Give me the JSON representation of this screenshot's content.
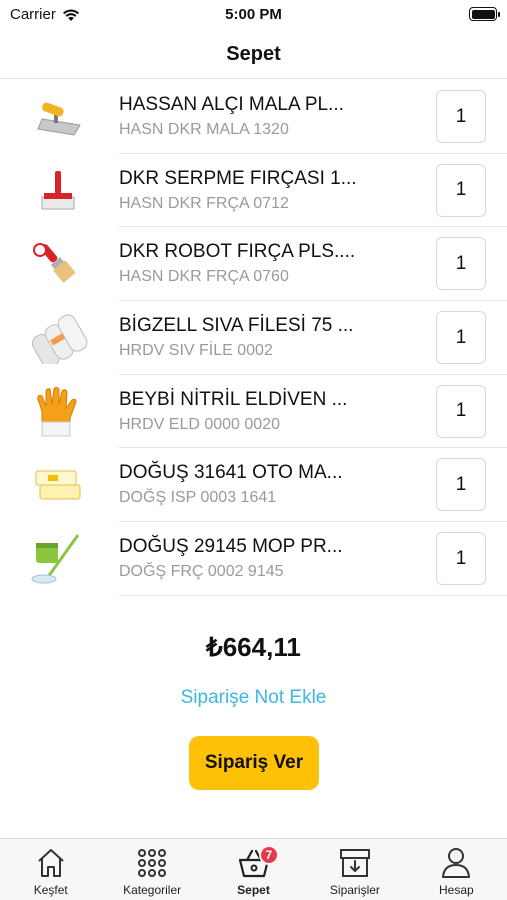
{
  "status_bar": {
    "carrier": "Carrier",
    "time": "5:00 PM"
  },
  "nav": {
    "title": "Sepet"
  },
  "cart": {
    "items": [
      {
        "name": "HASSAN ALÇI MALA PL...",
        "code": "HASN DKR MALA 1320",
        "qty": "1",
        "icon": "trowel-icon"
      },
      {
        "name": "DKR SERPME FIRÇASI 1...",
        "code": "HASN DKR FRÇA 0712",
        "qty": "1",
        "icon": "brush-icon"
      },
      {
        "name": "DKR ROBOT FIRÇA PLS....",
        "code": "HASN DKR FRÇA 0760",
        "qty": "1",
        "icon": "paint-brush-icon"
      },
      {
        "name": "BİGZELL SIVA FİLESİ 75 ...",
        "code": "HRDV SIV FİLE 0002",
        "qty": "1",
        "icon": "mesh-roll-icon"
      },
      {
        "name": "BEYBİ NİTRİL ELDİVEN ...",
        "code": "HRDV ELD 0000 0020",
        "qty": "1",
        "icon": "glove-icon"
      },
      {
        "name": "DOĞUŞ 31641 OTO MA...",
        "code": "DOĞŞ ISP 0003 1641",
        "qty": "1",
        "icon": "sponge-icon"
      },
      {
        "name": "DOĞUŞ 29145 MOP PR...",
        "code": "DOĞŞ FRÇ 0002 9145",
        "qty": "1",
        "icon": "mop-icon"
      }
    ]
  },
  "summary": {
    "total": "₺664,11",
    "add_note_label": "Siparişe Not Ekle",
    "order_button_label": "Sipariş Ver"
  },
  "tab_bar": {
    "tabs": [
      {
        "label": "Keşfet",
        "icon": "home-icon"
      },
      {
        "label": "Kategoriler",
        "icon": "grid-icon"
      },
      {
        "label": "Sepet",
        "icon": "basket-icon",
        "badge": "7",
        "active": true
      },
      {
        "label": "Siparişler",
        "icon": "orders-icon"
      },
      {
        "label": "Hesap",
        "icon": "user-icon"
      }
    ]
  },
  "colors": {
    "accent": "#ffc107",
    "link": "#3cb7e6",
    "badge": "#e8394a"
  }
}
